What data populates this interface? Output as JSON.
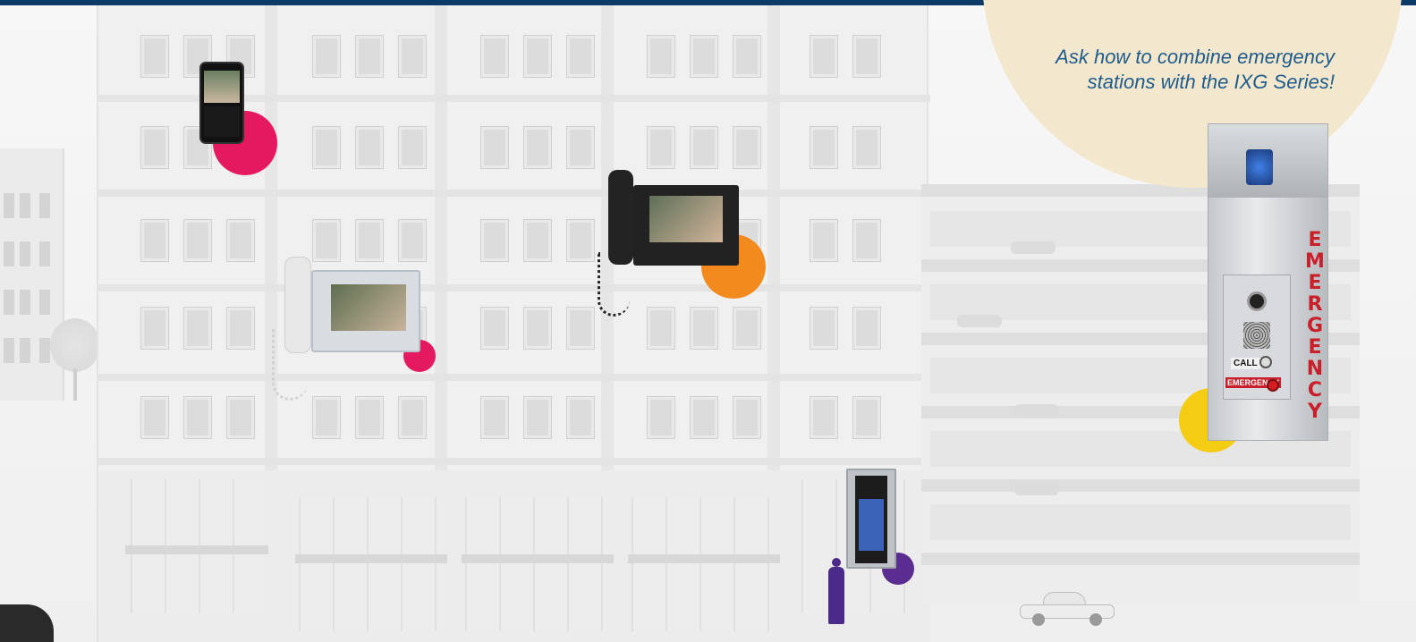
{
  "promo": {
    "line1": "Ask how to combine emergency",
    "line2": "stations with the IXG Series!"
  },
  "emergency_station": {
    "vertical_text": "EMERGENCY",
    "call_label": "CALL",
    "emergency_label": "EMERGENCY"
  },
  "colors": {
    "top_bar": "#0d3a66",
    "promo_text": "#1f5b8c",
    "promo_circle": "#f3e8cd",
    "dot_pink": "#e5195f",
    "dot_orange": "#f28a1e",
    "dot_yellow": "#f5cc14",
    "dot_purple": "#5b2d91",
    "emergency_red": "#c81f2a"
  },
  "icons": {
    "phone": "smartphone-app-icon",
    "monitor_white": "video-monitor-white-icon",
    "monitor_black": "video-monitor-black-icon",
    "door_station": "door-station-icon",
    "person": "person-silhouette-icon",
    "emergency_tower": "emergency-tower-icon"
  }
}
